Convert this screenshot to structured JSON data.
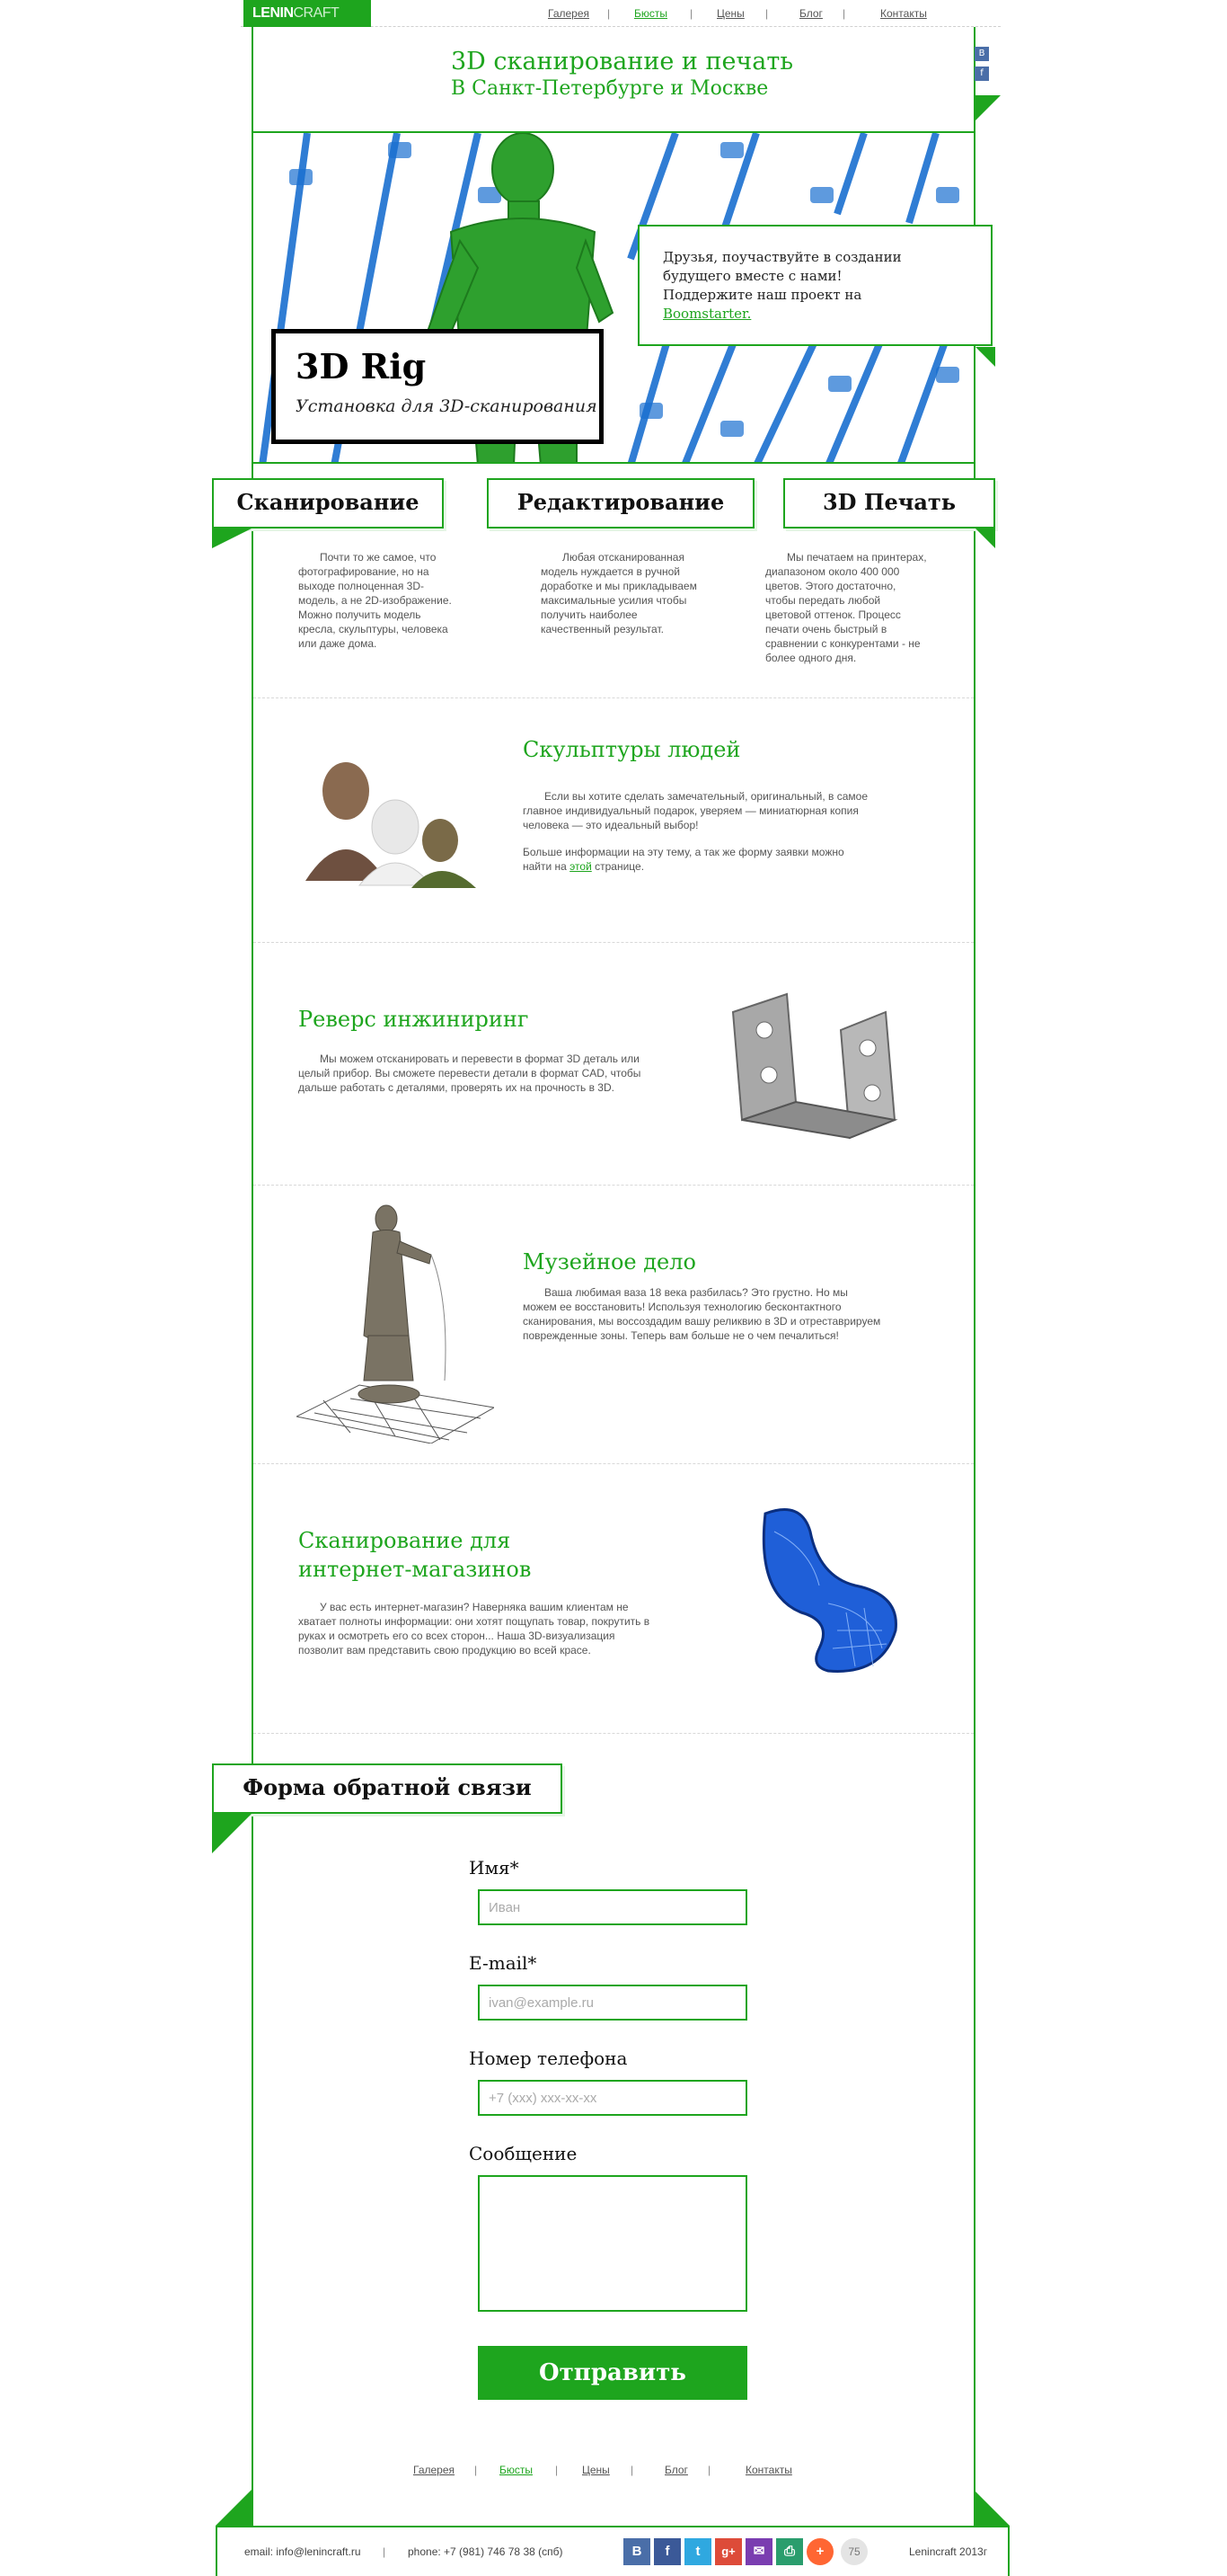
{
  "nav": {
    "logo_bold": "LENIN",
    "logo_light": "CRAFT",
    "links": [
      "Галерея",
      "Бюсты",
      "Цены",
      "Блог",
      "Контакты"
    ]
  },
  "header": {
    "title": "3D сканирование и печать",
    "subtitle": "В Санкт-Петербурге и Москве",
    "social": [
      "В",
      "f"
    ]
  },
  "hero": {
    "rig_title": "3D Rig",
    "rig_subtitle": "Установка для 3D-сканирования",
    "promo_text": "Друзья, поучаствуйте в создании будущего вместе с нами! Поддержите наш проект на ",
    "promo_link": "Boomstarter."
  },
  "services": [
    {
      "title": "Сканирование",
      "text": "Почти то же самое, что фотографирование, но на выходе полноценная 3D-модель, а не 2D-изображение. Можно получить модель кресла, скульптуры, человека или даже дома."
    },
    {
      "title": "Редактирование",
      "text": "Любая отсканированная модель нуждается в ручной доработке и мы прикладываем максимальные усилия чтобы получить наиболее качественный результат."
    },
    {
      "title": "3D Печать",
      "text": "Мы печатаем на принтерах, диапазоном около 400 000 цветов. Этого достаточно, чтобы передать любой цветовой оттенок. Процесс печати очень быстрый в сравнении с конкурентами - не более одного дня."
    }
  ],
  "sections": [
    {
      "title": "Скульптуры людей",
      "text1": "Если вы хотите сделать замечательный, оригинальный, в самое главное индивидуальный подарок, уверяем — миниатюрная копия человека — это идеальный выбор!",
      "text2_before": "Больше информации на эту тему, а так же форму заявки можно найти на ",
      "text2_link": "этой",
      "text2_after": " странице."
    },
    {
      "title": "Реверс инжиниринг",
      "text1": "Мы можем отсканировать и перевести в формат 3D деталь или целый прибор. Вы сможете перевести детали в формат CAD, чтобы дальше работать с деталями, проверять их на прочность в 3D."
    },
    {
      "title": "Музейное дело",
      "text1": "Ваша любимая ваза 18 века разбилась? Это грустно. Но мы можем ее восстановить! Используя технологию бесконтактного сканирования, мы воссоздадим вашу реликвию в 3D и отреставрируем поврежденные зоны. Теперь вам больше не о чем печалиться!"
    },
    {
      "title_line1": "Сканирование для",
      "title_line2": "интернет-магазинов",
      "text1": "У вас есть интернет-магазин? Наверняка вашим клиентам не хватает полноты информации: они хотят пощупать товар, покрутить в руках и осмотреть его со всех сторон... Наша 3D-визуализация позволит вам представить свою продукцию во всей красе."
    }
  ],
  "form": {
    "title": "Форма обратной связи",
    "name_label": "Имя*",
    "name_placeholder": "Иван",
    "email_label": "E-mail*",
    "email_placeholder": "ivan@example.ru",
    "phone_label": "Номер телефона",
    "phone_placeholder": "+7 (xxx) xxx-xx-xx",
    "message_label": "Сообщение",
    "submit": "Отправить"
  },
  "footer": {
    "links": [
      "Галерея",
      "Бюсты",
      "Цены",
      "Блог",
      "Контакты"
    ],
    "email": "email: info@lenincraft.ru",
    "phone": "phone: +7 (981) 746 78 38 (спб)",
    "share_count": "75",
    "copyright": "Lenincraft 2013г",
    "share_colors": [
      "#4a6ea8",
      "#3b5998",
      "#2fa8e0",
      "#dd4b39",
      "#7a3db0",
      "#2a9d6d",
      "#ff6633"
    ]
  }
}
